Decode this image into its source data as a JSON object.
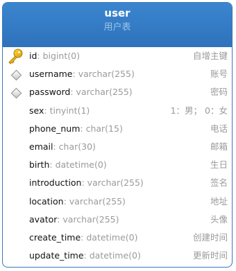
{
  "table": {
    "name": "user",
    "comment": "用户表"
  },
  "fields": [
    {
      "name": "id",
      "type": "bigint(0)",
      "comment": "自增主键",
      "marker": "key-icon"
    },
    {
      "name": "username",
      "type": "varchar(255)",
      "comment": "账号",
      "marker": "diamond-icon"
    },
    {
      "name": "password",
      "type": "varchar(255)",
      "comment": "密码",
      "marker": "diamond-icon"
    },
    {
      "name": "sex",
      "type": "tinyint(1)",
      "comment": "1：男； 0：女",
      "marker": ""
    },
    {
      "name": "phone_num",
      "type": "char(15)",
      "comment": "电话",
      "marker": ""
    },
    {
      "name": "email",
      "type": "char(30)",
      "comment": "邮箱",
      "marker": ""
    },
    {
      "name": "birth",
      "type": "datetime(0)",
      "comment": "生日",
      "marker": ""
    },
    {
      "name": "introduction",
      "type": "varchar(255)",
      "comment": "签名",
      "marker": ""
    },
    {
      "name": "location",
      "type": "varchar(255)",
      "comment": "地址",
      "marker": ""
    },
    {
      "name": "avator",
      "type": "varchar(255)",
      "comment": "头像",
      "marker": ""
    },
    {
      "name": "create_time",
      "type": "datetime(0)",
      "comment": "创建时间",
      "marker": ""
    },
    {
      "name": "update_time",
      "type": "datetime(0)",
      "comment": "更新时间",
      "marker": ""
    }
  ],
  "colors": {
    "header": "#2e72bb",
    "border": "#3876be",
    "key": "#e8a800"
  }
}
